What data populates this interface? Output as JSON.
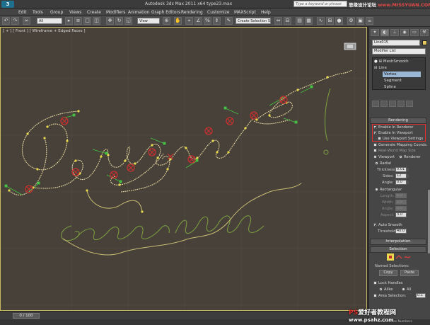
{
  "titlebar": {
    "logo": "3",
    "title": "Autodesk 3ds Max  2011 x64      type23.max",
    "help_search_placeholder": "Type a keyword or phrase",
    "watermark": "思缘设计论坛",
    "watermark_url": "www.MISSYUAN.COM"
  },
  "menu": [
    "Edit",
    "Tools",
    "Group",
    "Views",
    "Create",
    "Modifiers",
    "Animation",
    "Graph Editors",
    "Rendering",
    "Customize",
    "MAXScript",
    "Help"
  ],
  "toolbar": {
    "selection_filter": "All",
    "reference_coord": "View",
    "named_selection": "Create Selection Se"
  },
  "viewport": {
    "label": "[ + ] [ Front ] [ Wireframe + Edged Faces ]",
    "spline_color": "#e8d8a0",
    "dark_spline_color": "#7a9a40",
    "vertex_color": "#e8d84a",
    "handle_color": "#44c444"
  },
  "command_panel": {
    "object_name": "Line015",
    "modifier_list": "Modifier List",
    "stack": [
      "MeshSmooth",
      "Line",
      "Vertex",
      "Segment",
      "Spline"
    ],
    "stack_selected": "Vertex",
    "rendering": {
      "header": "Rendering",
      "enable_in_renderer": "Enable In Renderer",
      "enable_in_viewport": "Enable In Viewport",
      "use_viewport_settings": "Use Viewport Settings",
      "generate_mapping": "Generate Mapping Coords.",
      "real_world_map": "Real-World Map Size",
      "viewport_label": "Viewport",
      "renderer_label": "Renderer",
      "radial_label": "Radial",
      "thickness_label": "Thickness:",
      "thickness_value": "0.01",
      "sides_label": "Sides:",
      "sides_value": "12",
      "angle_label": "Angle:",
      "angle_value": "0.0",
      "rectangular_label": "Rectangular",
      "length_label": "Length:",
      "length_value": "6.0",
      "width_label": "Width:",
      "width_value": "2.0",
      "angle2_label": "Angle:",
      "angle2_value": "0.0",
      "aspect_label": "Aspect:",
      "aspect_value": "3.0",
      "auto_smooth_label": "Auto Smooth",
      "threshold_label": "Threshold:",
      "threshold_value": "40.0"
    },
    "interpolation_header": "Interpolation",
    "selection_header": "Selection",
    "named_selections_label": "Named Selections:",
    "copy_label": "Copy",
    "paste_label": "Paste",
    "lock_handles_label": "Lock Handles",
    "alike_label": "Alike",
    "all_label": "All",
    "area_selection_label": "Area Selection:",
    "area_selection_value": "0.1"
  },
  "timebar": {
    "frame": "0 / 100",
    "show_vertex_numbers": "Show Vertex Numbers"
  },
  "watermark_bottom": {
    "line1_a": "PS",
    "line1_b": "爱好者教程网",
    "url": "www.psahz.com"
  }
}
